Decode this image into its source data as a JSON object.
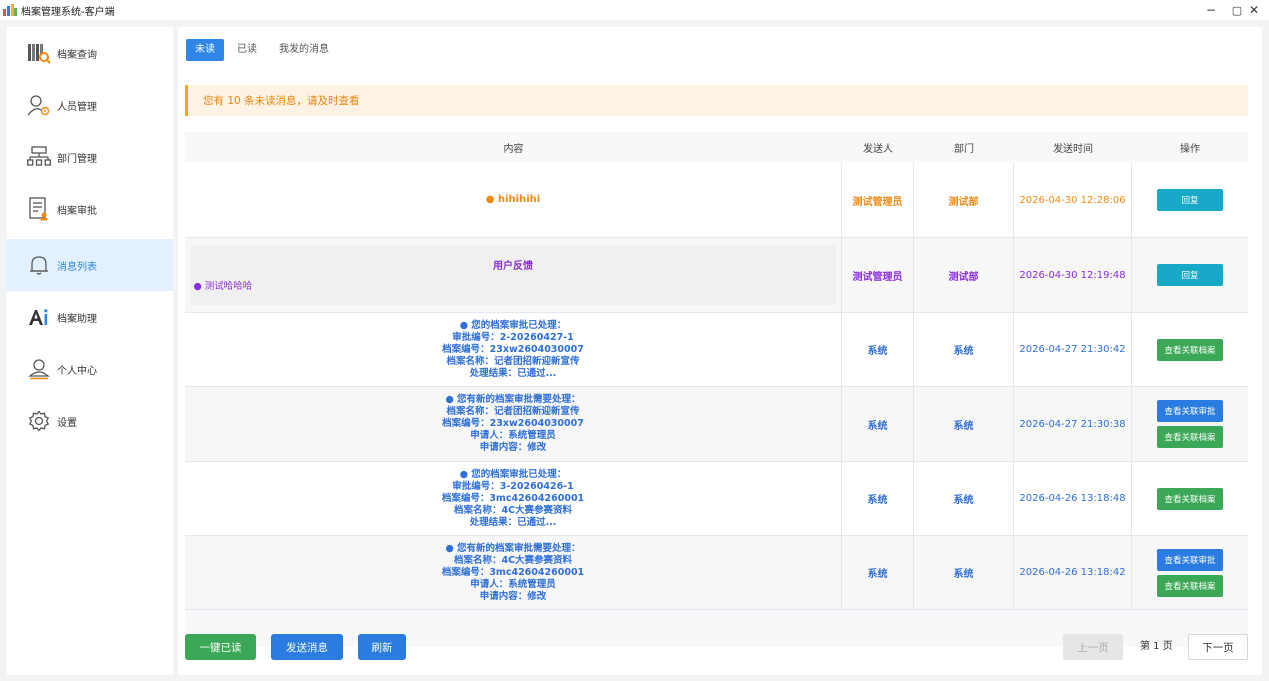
{
  "window": {
    "title": "档案管理系统-客户端",
    "controls": {
      "minimize": "−",
      "maximize": "▢",
      "close": "✕"
    }
  },
  "sidebar": {
    "items": [
      {
        "label": "档案查询",
        "icon": "archive-search-icon",
        "active": false
      },
      {
        "label": "人员管理",
        "icon": "user-gear-icon",
        "active": false
      },
      {
        "label": "部门管理",
        "icon": "org-tree-icon",
        "active": false
      },
      {
        "label": "档案审批",
        "icon": "document-approve-icon",
        "active": false
      },
      {
        "label": "消息列表",
        "icon": "bell-icon",
        "active": true
      },
      {
        "label": "档案助理",
        "icon": "ai-icon",
        "active": false
      },
      {
        "label": "个人中心",
        "icon": "person-icon",
        "active": false
      },
      {
        "label": "设置",
        "icon": "gear-icon",
        "active": false
      }
    ]
  },
  "tabs": [
    {
      "label": "未读",
      "active": true
    },
    {
      "label": "已读",
      "active": false
    },
    {
      "label": "我发的消息",
      "active": false
    }
  ],
  "notice": "您有 10 条未读消息，请及时查看",
  "table": {
    "headers": [
      "内容",
      "发送人",
      "部门",
      "发送时间",
      "操作"
    ],
    "rows": [
      {
        "content": [
          "● hihihihi"
        ],
        "sender": "测试管理员",
        "dept": "测试部",
        "time": "2026-04-30 12:28:06",
        "actions": [
          "回复"
        ]
      },
      {
        "content_title": "用户反馈",
        "content_body": "● 测试哈哈哈",
        "sender": "测试管理员",
        "dept": "测试部",
        "time": "2026-04-30 12:19:48",
        "actions": [
          "回复"
        ]
      },
      {
        "content": [
          "● 您的档案审批已处理：",
          "审批编号：2-20260427-1",
          "档案编号：23xw2604030007",
          "档案名称：记者团招新迎新宣传",
          "处理结果：已通过..."
        ],
        "sender": "系统",
        "dept": "系统",
        "time": "2026-04-27 21:30:42",
        "actions": [
          "查看关联档案"
        ]
      },
      {
        "content": [
          "● 您有新的档案审批需要处理：",
          "档案名称：记者团招新迎新宣传",
          "档案编号：23xw2604030007",
          "申请人：系统管理员",
          "申请内容：修改"
        ],
        "sender": "系统",
        "dept": "系统",
        "time": "2026-04-27 21:30:38",
        "actions": [
          "查看关联审批",
          "查看关联档案"
        ]
      },
      {
        "content": [
          "● 您的档案审批已处理：",
          "审批编号：3-20260426-1",
          "档案编号：3mc42604260001",
          "档案名称：4C大赛参赛资料",
          "处理结果：已通过..."
        ],
        "sender": "系统",
        "dept": "系统",
        "time": "2026-04-26 13:18:48",
        "actions": [
          "查看关联档案"
        ]
      },
      {
        "content": [
          "● 您有新的档案审批需要处理：",
          "档案名称：4C大赛参赛资料",
          "档案编号：3mc42604260001",
          "申请人：系统管理员",
          "申请内容：修改"
        ],
        "sender": "系统",
        "dept": "系统",
        "time": "2026-04-26 13:18:42",
        "actions": [
          "查看关联审批",
          "查看关联档案"
        ]
      }
    ]
  },
  "footer": {
    "mark_all_read": "一键已读",
    "send_message": "发送消息",
    "refresh": "刷新",
    "prev_page": "上一页",
    "page_info": "第 1 页",
    "next_page": "下一页"
  },
  "colors": {
    "primary": "#2f86e6",
    "orange": "#f08a16",
    "purple": "#8a2ed8",
    "blue_text": "#2f6fd8",
    "reply_button": "#17a9c7",
    "green_button": "#3aa856",
    "blue_button": "#2a7ce0"
  }
}
